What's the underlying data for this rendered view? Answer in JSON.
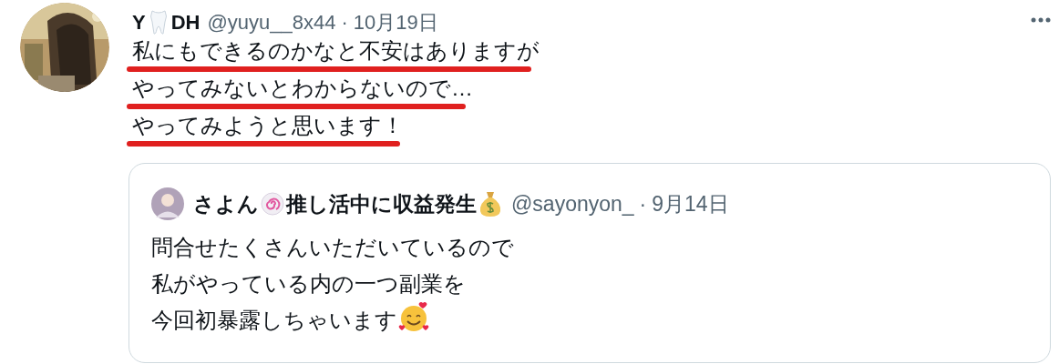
{
  "tweet": {
    "name_parts": [
      {
        "kind": "text",
        "text": "Y"
      },
      {
        "kind": "tooth"
      },
      {
        "kind": "text",
        "text": "DH"
      }
    ],
    "handle": "@yuyu__8x44",
    "separator": "·",
    "date": "10月19日",
    "lines": [
      {
        "text": "私にもできるのかなと不安はありますが",
        "underlined": true
      },
      {
        "text": "やってみないとわからないので…",
        "underlined": true
      },
      {
        "text": "やってみようと思います！",
        "underlined": true
      }
    ]
  },
  "quoted_tweet": {
    "name_parts": [
      {
        "kind": "text",
        "text": "さよん"
      },
      {
        "kind": "spiral"
      },
      {
        "kind": "text",
        "text": "推し活中に収益発生"
      },
      {
        "kind": "moneybag"
      }
    ],
    "handle": "@sayonyon_",
    "separator": "·",
    "date": "9月14日",
    "lines": [
      {
        "kind": "text",
        "text": "問合せたくさんいただいているので"
      },
      {
        "kind": "text",
        "text": "私がやっている内の一つ副業を"
      },
      {
        "kind": "hearts_face",
        "text": "今回初暴露しちゃいます"
      }
    ]
  }
}
